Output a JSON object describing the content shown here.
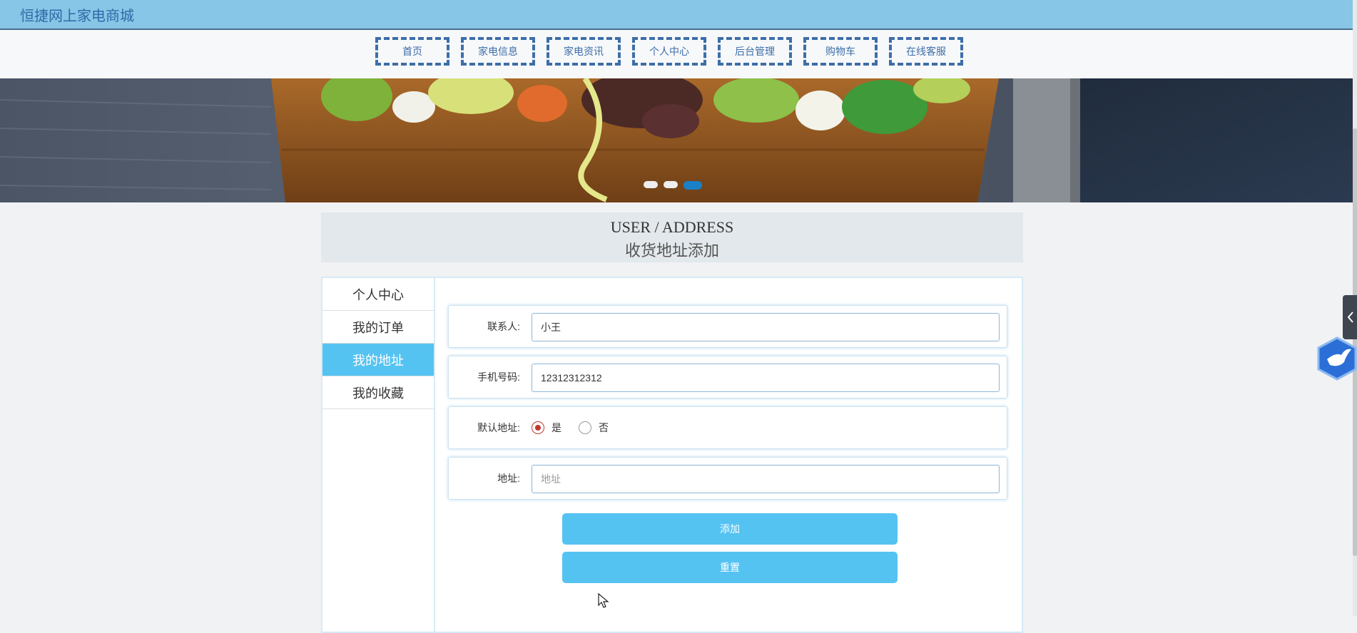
{
  "app": {
    "title": "恒捷网上家电商城"
  },
  "nav": {
    "items": [
      "首页",
      "家电信息",
      "家电资讯",
      "个人中心",
      "后台管理",
      "购物车",
      "在线客服"
    ]
  },
  "carousel": {
    "dots": 3,
    "active_dot": 3
  },
  "page_header": {
    "en": "USER / ADDRESS",
    "cn": "收货地址添加"
  },
  "sidebar": {
    "items": [
      "个人中心",
      "我的订单",
      "我的地址",
      "我的收藏"
    ],
    "active": "我的地址"
  },
  "form": {
    "contact": {
      "label": "联系人:",
      "value": "小王"
    },
    "phone": {
      "label": "手机号码:",
      "value": "12312312312"
    },
    "default_address": {
      "label": "默认地址:",
      "options": [
        "是",
        "否"
      ],
      "selected": "是"
    },
    "address": {
      "label": "地址:",
      "value": "",
      "placeholder": "地址"
    }
  },
  "buttons": {
    "add": "添加",
    "reset": "重置"
  },
  "colors": {
    "topbar": "#87c6e6",
    "nav_border": "#3d6ea8",
    "accent": "#55c3f2",
    "radio_checked": "#c0392b"
  },
  "icons": [
    "chevron-left-icon",
    "bird-icon",
    "mouse-cursor-icon"
  ]
}
